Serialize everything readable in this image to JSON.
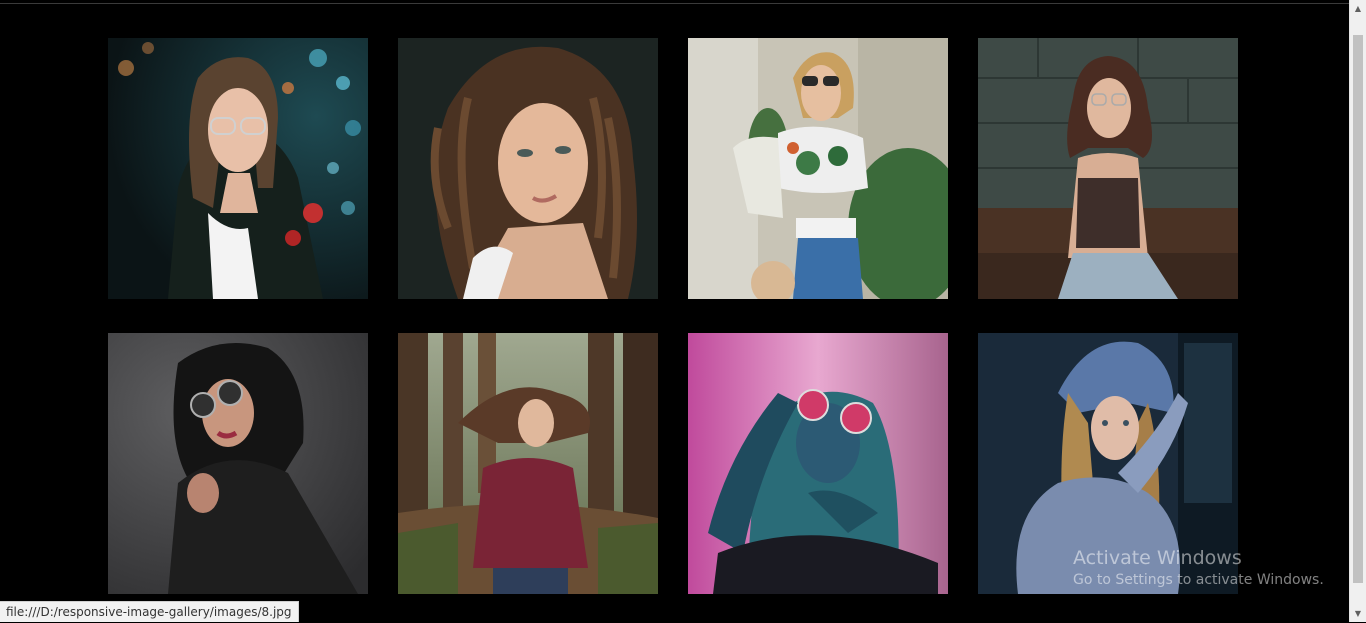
{
  "gallery": {
    "images": [
      {
        "name": "Woman with glasses at night with bokeh lights"
      },
      {
        "name": "Woman with curly brown hair portrait"
      },
      {
        "name": "Woman in sunglasses with floral top"
      },
      {
        "name": "Woman with glasses sitting by wall"
      },
      {
        "name": "Woman in black jacket with round sunglasses"
      },
      {
        "name": "Woman with flowing hair in forest"
      },
      {
        "name": "Woman with neon lighting and sunglasses"
      },
      {
        "name": "Woman in plaid hat leaning by window"
      }
    ]
  },
  "status_bar": {
    "url": "file:///D:/responsive-image-gallery/images/8.jpg"
  },
  "watermark": {
    "title": "Activate Windows",
    "text": "Go to Settings to activate Windows."
  },
  "scrollbar": {
    "up_arrow": "▲",
    "down_arrow": "▼"
  }
}
